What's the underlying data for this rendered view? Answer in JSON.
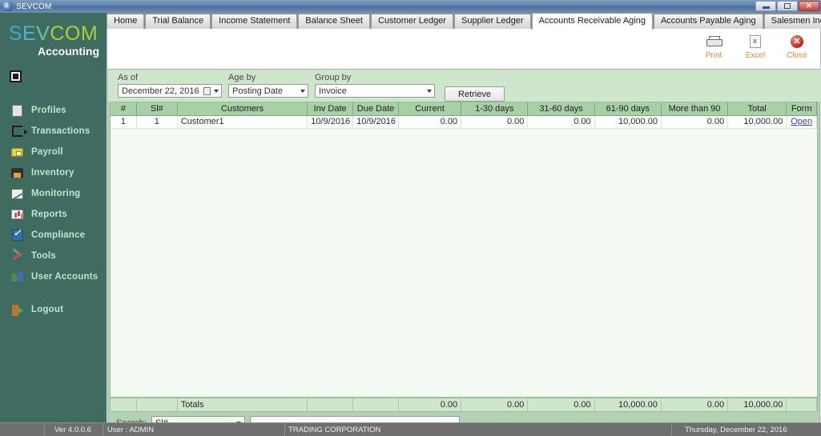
{
  "window": {
    "title": "SEVCOM",
    "app_icon": "sevcom-logo-icon",
    "minimize_label": "Minimize",
    "maximize_label": "Maximize",
    "close_label": "Close"
  },
  "sidebar": {
    "logo": {
      "part1": "S",
      "part2": "E",
      "part3": "V",
      "part4": "COM",
      "subtitle": "Accounting"
    },
    "panel_toggle": "panel-toggle",
    "items": [
      {
        "label": "Profiles",
        "icon": "profiles-icon"
      },
      {
        "label": "Transactions",
        "icon": "transactions-icon"
      },
      {
        "label": "Payroll",
        "icon": "payroll-icon"
      },
      {
        "label": "Inventory",
        "icon": "inventory-icon"
      },
      {
        "label": "Monitoring",
        "icon": "monitoring-icon"
      },
      {
        "label": "Reports",
        "icon": "reports-icon"
      },
      {
        "label": "Compliance",
        "icon": "compliance-icon"
      },
      {
        "label": "Tools",
        "icon": "tools-icon"
      },
      {
        "label": "User Accounts",
        "icon": "user-accounts-icon"
      }
    ],
    "logout": {
      "label": "Logout",
      "icon": "logout-icon"
    }
  },
  "tabs": [
    {
      "label": "Home",
      "active": false
    },
    {
      "label": "Trial Balance",
      "active": false
    },
    {
      "label": "Income Statement",
      "active": false
    },
    {
      "label": "Balance Sheet",
      "active": false
    },
    {
      "label": "Customer Ledger",
      "active": false
    },
    {
      "label": "Supplier Ledger",
      "active": false
    },
    {
      "label": "Accounts Receivable Aging",
      "active": true
    },
    {
      "label": "Accounts Payable Aging",
      "active": false
    },
    {
      "label": "Salesmen Incentive",
      "active": false
    }
  ],
  "toolbar": {
    "print_label": "Print",
    "excel_label": "Excel",
    "close_label": "Close"
  },
  "filters": {
    "as_of_label": "As of",
    "as_of_value": "December 22, 2016",
    "age_by_label": "Age by",
    "age_by_value": "Posting Date",
    "group_by_label": "Group by",
    "group_by_value": "Invoice",
    "retrieve_label": "Retrieve"
  },
  "table": {
    "columns": [
      "#",
      "Sl#",
      "Customers",
      "Inv Date",
      "Due Date",
      "Current",
      "1-30 days",
      "31-60 days",
      "61-90 days",
      "More than 90",
      "Total",
      "Form"
    ],
    "rows": [
      {
        "num": "1",
        "sl": "1",
        "customer": "Customer1",
        "inv_date": "10/9/2016",
        "due_date": "10/9/2016",
        "current": "0.00",
        "d1_30": "0.00",
        "d31_60": "0.00",
        "d61_90": "10,000.00",
        "more_90": "0.00",
        "total": "10,000.00",
        "form": "Open"
      }
    ],
    "totals": {
      "label": "Totals",
      "current": "0.00",
      "d1_30": "0.00",
      "d31_60": "0.00",
      "d61_90": "10,000.00",
      "more_90": "0.00",
      "total": "10,000.00"
    }
  },
  "search": {
    "label": "Search:",
    "field_value": "Sl#",
    "input_value": "",
    "placeholder": ""
  },
  "statusbar": {
    "version": "Ver 4.0.0.6",
    "user": "User : ADMIN",
    "company": "TRADING CORPORATION",
    "date": "Thursday, December 22, 2016"
  },
  "colors": {
    "sidebar_bg": "#3f6b60",
    "report_bg": "#b3d1b3",
    "header_green": "#a7d0a7",
    "accent_orange": "#e08a2e",
    "link_blue": "#3a3ad0"
  }
}
